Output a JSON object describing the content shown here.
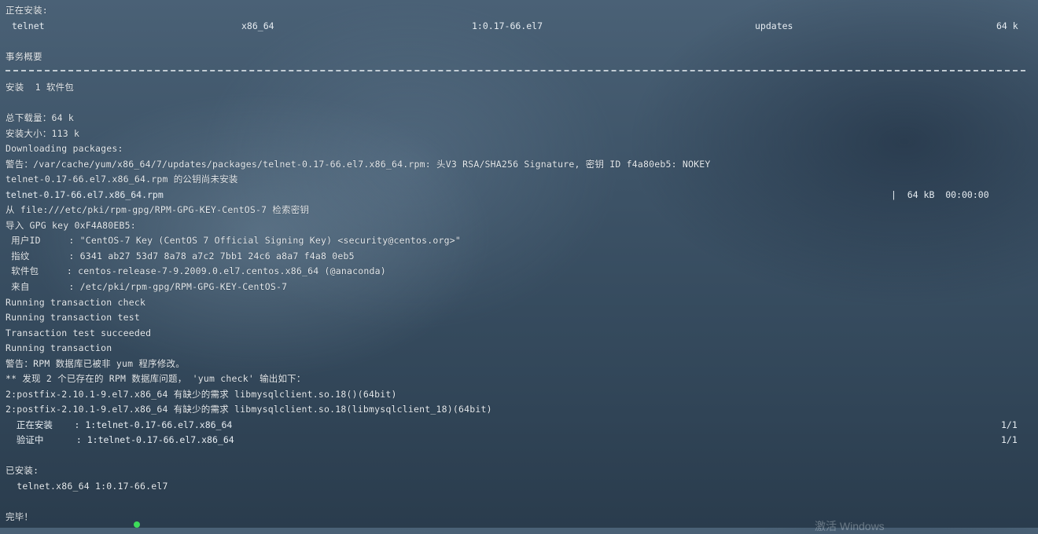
{
  "section_installing": "正在安装:",
  "package_row": {
    "name": "telnet",
    "arch": "x86_64",
    "version": "1:0.17-66.el7",
    "repo": "updates",
    "size": "64 k"
  },
  "transaction_summary": "事务概要",
  "install_count": "安装  1 软件包",
  "total_download": "总下载量：64 k",
  "installed_size": "安装大小：113 k",
  "downloading": "Downloading packages:",
  "warning_key": "警告：/var/cache/yum/x86_64/7/updates/packages/telnet-0.17-66.el7.x86_64.rpm: 头V3 RSA/SHA256 Signature, 密钥 ID f4a80eb5: NOKEY",
  "pubkey_not_installed": "telnet-0.17-66.el7.x86_64.rpm 的公钥尚未安装",
  "download_row": {
    "file": "telnet-0.17-66.el7.x86_64.rpm",
    "size": "|  64 kB  00:00:00"
  },
  "retrieve_key": "从 file:///etc/pki/rpm-gpg/RPM-GPG-KEY-CentOS-7 检索密钥",
  "import_key": "导入 GPG key 0xF4A80EB5:",
  "key_userid": " 用户ID     : \"CentOS-7 Key (CentOS 7 Official Signing Key) <security@centos.org>\"",
  "key_fingerprint": " 指纹       : 6341 ab27 53d7 8a78 a7c2 7bb1 24c6 a8a7 f4a8 0eb5",
  "key_package": " 软件包     : centos-release-7-9.2009.0.el7.centos.x86_64 (@anaconda)",
  "key_from": " 来自       : /etc/pki/rpm-gpg/RPM-GPG-KEY-CentOS-7",
  "running_check": "Running transaction check",
  "running_test": "Running transaction test",
  "test_succeeded": "Transaction test succeeded",
  "running_transaction": "Running transaction",
  "warning_rpmdb": "警告：RPM 数据库已被非 yum 程序修改。",
  "found_problems": "** 发现 2 个已存在的 RPM 数据库问题， 'yum check' 输出如下：",
  "postfix_1": "2:postfix-2.10.1-9.el7.x86_64 有缺少的需求 libmysqlclient.so.18()(64bit)",
  "postfix_2": "2:postfix-2.10.1-9.el7.x86_64 有缺少的需求 libmysqlclient.so.18(libmysqlclient_18)(64bit)",
  "progress_installing": {
    "text": "  正在安装    : 1:telnet-0.17-66.el7.x86_64",
    "count": "1/1"
  },
  "progress_verifying": {
    "text": "  验证中      : 1:telnet-0.17-66.el7.x86_64",
    "count": "1/1"
  },
  "installed_header": "已安装:",
  "installed_pkg": "  telnet.x86_64 1:0.17-66.el7",
  "complete": "完毕！",
  "watermark": "激活 Windows",
  "colors": {
    "text": "#e6ecf1",
    "background": "#3d5367",
    "cursor": "#3ddc5a"
  }
}
